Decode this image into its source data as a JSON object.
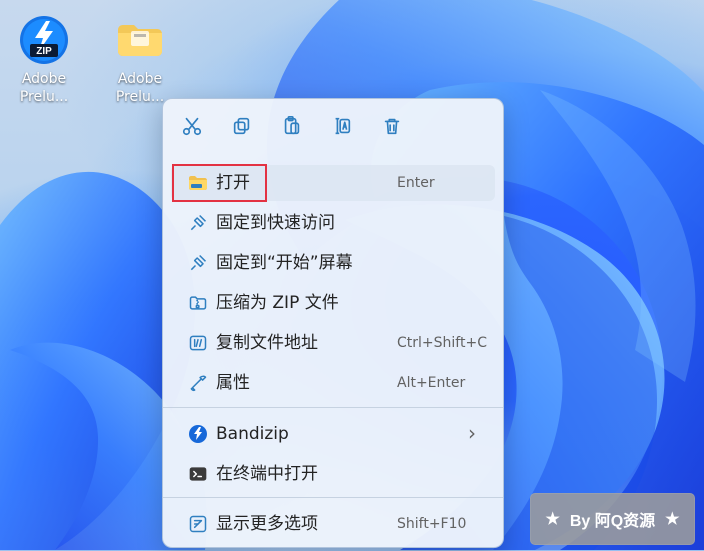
{
  "desktop": {
    "icons": [
      {
        "label": "Adobe\nPrelu..."
      },
      {
        "label": "Adobe\nPrelu..."
      }
    ]
  },
  "context_menu": {
    "items": [
      {
        "label": "打开",
        "shortcut": "Enter"
      },
      {
        "label": "固定到快速访问",
        "shortcut": ""
      },
      {
        "label": "固定到“开始”屏幕",
        "shortcut": ""
      },
      {
        "label": "压缩为 ZIP 文件",
        "shortcut": ""
      },
      {
        "label": "复制文件地址",
        "shortcut": "Ctrl+Shift+C"
      },
      {
        "label": "属性",
        "shortcut": "Alt+Enter"
      },
      {
        "label": "Bandizip",
        "shortcut": ""
      },
      {
        "label": "在终端中打开",
        "shortcut": ""
      },
      {
        "label": "显示更多选项",
        "shortcut": "Shift+F10"
      }
    ],
    "submenu_arrow": "›"
  },
  "watermark": {
    "star_left": "★",
    "text": "By 阿Q资源",
    "star_right": "★"
  }
}
